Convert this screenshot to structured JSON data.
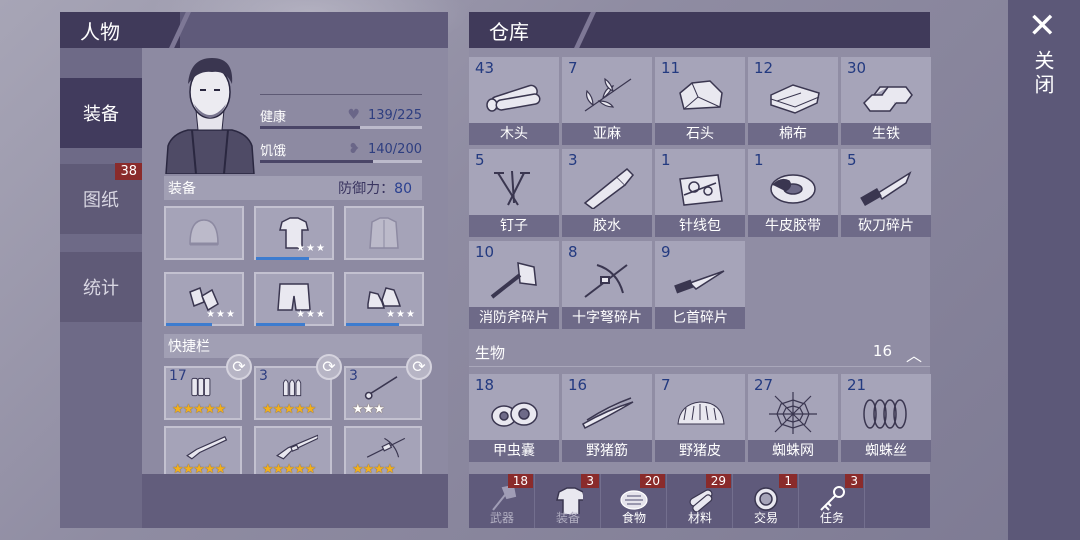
{
  "character": {
    "title": "人物",
    "tabs": [
      {
        "label": "装备",
        "badge": ""
      },
      {
        "label": "图纸",
        "badge": "38"
      },
      {
        "label": "统计",
        "badge": ""
      }
    ],
    "health": {
      "label": "健康",
      "value": "139/225",
      "fraction": 0.62
    },
    "hunger": {
      "label": "饥饿",
      "value": "140/200",
      "fraction": 0.7
    },
    "equip_label": "装备",
    "defense_label": "防御力：",
    "defense_value": "80",
    "equipment": [
      {
        "icon": "beanie-hat-icon",
        "stars": "",
        "durability": 0
      },
      {
        "icon": "shirt-icon",
        "stars": "★★★",
        "durability": 0.7
      },
      {
        "icon": "coat-icon",
        "stars": "",
        "durability": 0
      },
      {
        "icon": "gloves-icon",
        "stars": "★★★",
        "durability": 0.6
      },
      {
        "icon": "shorts-icon",
        "stars": "★★★",
        "durability": 0.65
      },
      {
        "icon": "sneakers-icon",
        "stars": "★★★",
        "durability": 0.7
      }
    ],
    "quickbar_label": "快捷栏",
    "quickbar": [
      {
        "count": "17",
        "icon": "shotgun-shells-icon",
        "stars": "★★★★★",
        "durability": 0
      },
      {
        "count": "3",
        "icon": "bullets-icon",
        "stars": "★★★★★",
        "durability": 0
      },
      {
        "count": "3",
        "icon": "crossbow-bolt-icon",
        "stars": "★★★",
        "durability": 0
      },
      {
        "count": "",
        "icon": "shotgun-icon",
        "stars": "★★★★★",
        "durability": 0.9
      },
      {
        "count": "",
        "icon": "rifle-icon",
        "stars": "★★★★★",
        "durability": 0.95
      },
      {
        "count": "",
        "icon": "crossbow-icon",
        "stars": "★★★★",
        "durability": 0.3
      }
    ]
  },
  "warehouse": {
    "title": "仓库",
    "materials": [
      {
        "count": "43",
        "name": "木头",
        "icon": "wood-icon"
      },
      {
        "count": "7",
        "name": "亚麻",
        "icon": "flax-icon"
      },
      {
        "count": "11",
        "name": "石头",
        "icon": "stone-icon"
      },
      {
        "count": "12",
        "name": "棉布",
        "icon": "cloth-icon"
      },
      {
        "count": "30",
        "name": "生铁",
        "icon": "iron-ingot-icon"
      },
      {
        "count": "5",
        "name": "钉子",
        "icon": "nails-icon"
      },
      {
        "count": "3",
        "name": "胶水",
        "icon": "glue-icon"
      },
      {
        "count": "1",
        "name": "针线包",
        "icon": "sewing-kit-icon"
      },
      {
        "count": "1",
        "name": "牛皮胶带",
        "icon": "duct-tape-icon"
      },
      {
        "count": "5",
        "name": "砍刀碎片",
        "icon": "machete-fragment-icon"
      },
      {
        "count": "10",
        "name": "消防斧碎片",
        "icon": "fire-axe-fragment-icon"
      },
      {
        "count": "8",
        "name": "十字弩碎片",
        "icon": "crossbow-fragment-icon"
      },
      {
        "count": "9",
        "name": "匕首碎片",
        "icon": "dagger-fragment-icon"
      }
    ],
    "bio_category": {
      "label": "生物",
      "count": "16"
    },
    "bio": [
      {
        "count": "18",
        "name": "甲虫囊",
        "icon": "beetle-sac-icon"
      },
      {
        "count": "16",
        "name": "野猪筋",
        "icon": "boar-sinew-icon"
      },
      {
        "count": "7",
        "name": "野猪皮",
        "icon": "boar-hide-icon"
      },
      {
        "count": "27",
        "name": "蜘蛛网",
        "icon": "spider-web-icon"
      },
      {
        "count": "21",
        "name": "蜘蛛丝",
        "icon": "spider-silk-icon"
      }
    ],
    "bottom_tabs": [
      {
        "label": "武器",
        "badge": "18",
        "icon": "axe-icon",
        "active": false
      },
      {
        "label": "装备",
        "badge": "3",
        "icon": "shirt-icon",
        "active": false
      },
      {
        "label": "食物",
        "badge": "20",
        "icon": "meat-icon",
        "active": true
      },
      {
        "label": "材料",
        "badge": "29",
        "icon": "log-icon",
        "active": true
      },
      {
        "label": "交易",
        "badge": "1",
        "icon": "coin-icon",
        "active": true
      },
      {
        "label": "任务",
        "badge": "3",
        "icon": "key-icon",
        "active": true
      }
    ]
  },
  "close_label": "关闭"
}
